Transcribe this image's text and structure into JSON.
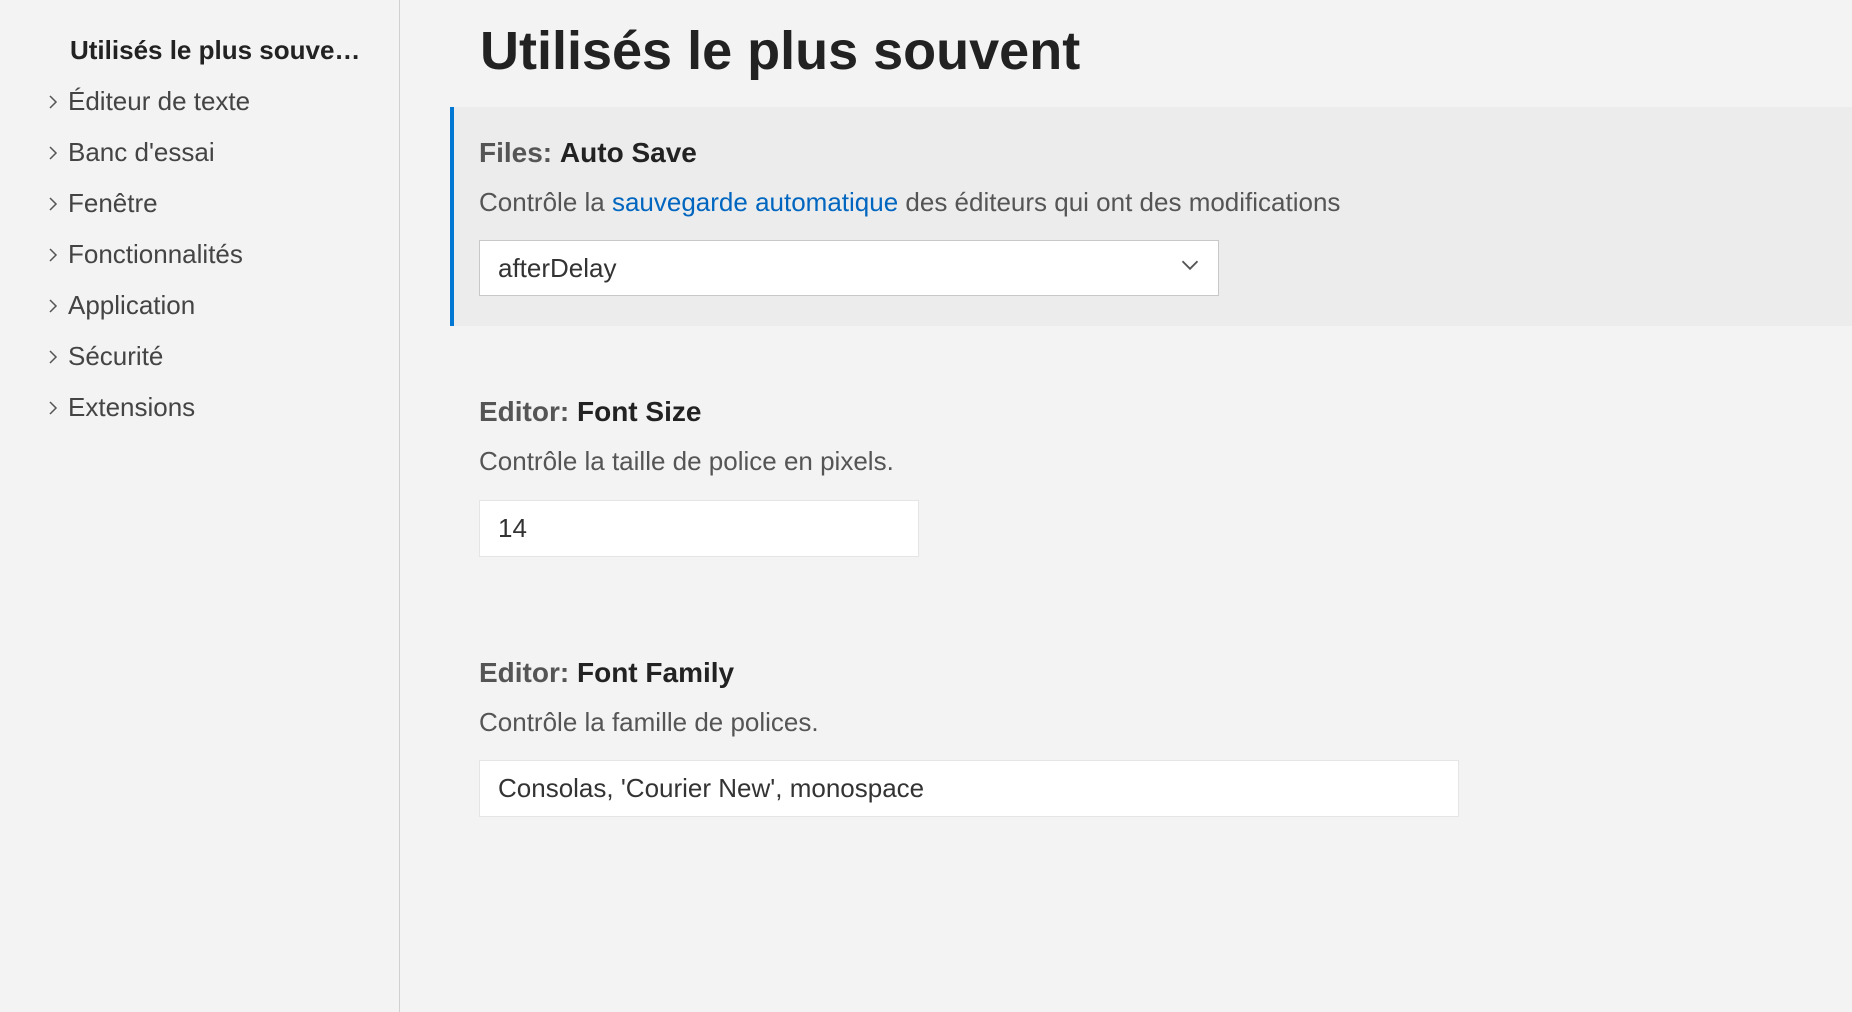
{
  "sidebar": {
    "activeLabel": "Utilisés le plus souve…",
    "items": [
      {
        "label": "Éditeur de texte"
      },
      {
        "label": "Banc d'essai"
      },
      {
        "label": "Fenêtre"
      },
      {
        "label": "Fonctionnalités"
      },
      {
        "label": "Application"
      },
      {
        "label": "Sécurité"
      },
      {
        "label": "Extensions"
      }
    ]
  },
  "main": {
    "title": "Utilisés le plus souvent",
    "settings": {
      "autoSave": {
        "prefix": "Files: ",
        "name": "Auto Save",
        "descBefore": "Contrôle la ",
        "descLink": "sauvegarde automatique",
        "descAfter": " des éditeurs qui ont des modifications",
        "value": "afterDelay"
      },
      "fontSize": {
        "prefix": "Editor: ",
        "name": "Font Size",
        "desc": "Contrôle la taille de police en pixels.",
        "value": "14"
      },
      "fontFamily": {
        "prefix": "Editor: ",
        "name": "Font Family",
        "desc": "Contrôle la famille de polices.",
        "value": "Consolas, 'Courier New', monospace"
      }
    }
  }
}
